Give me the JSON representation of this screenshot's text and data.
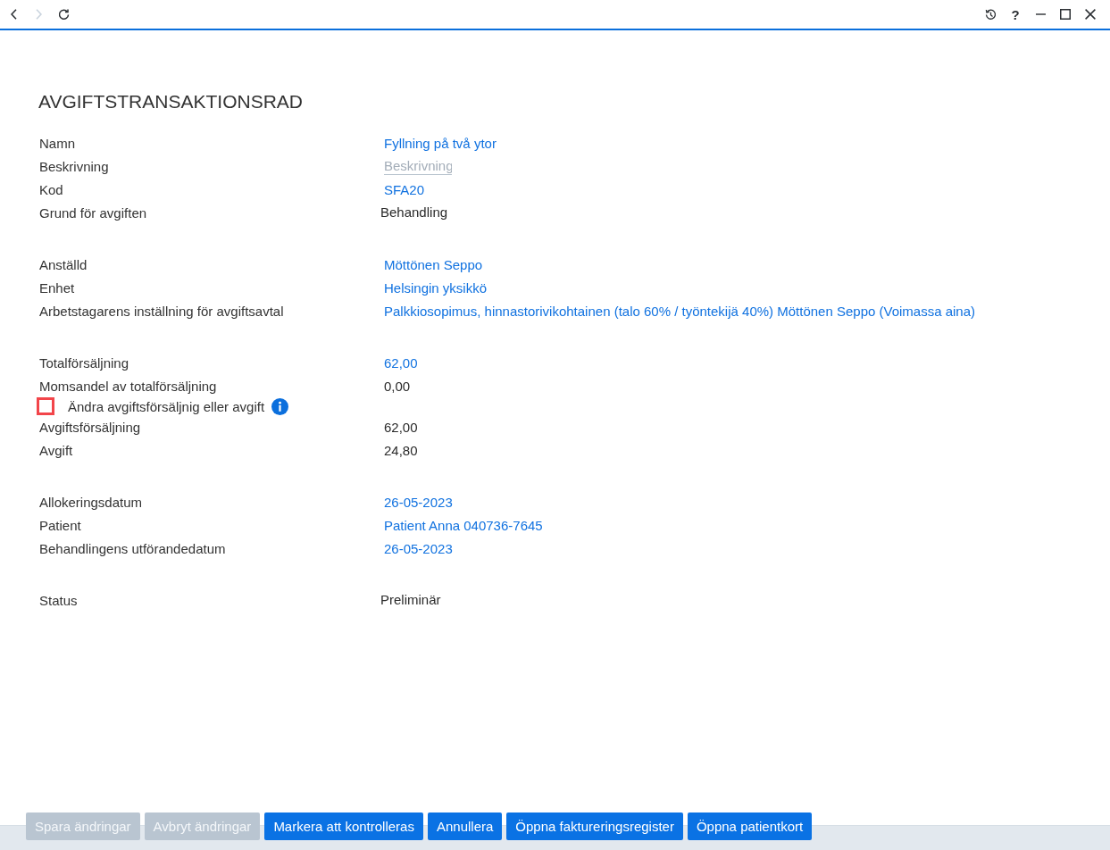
{
  "toolbar": {
    "nav": [
      {
        "kind": "back",
        "disabled": false
      },
      {
        "kind": "forward",
        "disabled": true
      },
      {
        "kind": "refresh",
        "disabled": false
      }
    ],
    "actions": [
      {
        "kind": "history"
      },
      {
        "kind": "help",
        "label": "?"
      },
      {
        "kind": "minimize"
      },
      {
        "kind": "maximize"
      },
      {
        "kind": "close"
      }
    ]
  },
  "title": "AVGIFTSTRANSAKTIONSRAD",
  "groups": [
    {
      "rows": [
        {
          "kind": "link",
          "label": "Namn",
          "value": "Fyllning på två ytor"
        },
        {
          "kind": "field",
          "label": "Beskrivning",
          "placeholder": "Beskrivning"
        },
        {
          "kind": "link",
          "label": "Kod",
          "value": "SFA20"
        },
        {
          "kind": "choice",
          "label": "Grund för avgiften",
          "value": "Behandling"
        }
      ]
    },
    {
      "rows": [
        {
          "kind": "link",
          "label": "Anställd",
          "value": "Möttönen Seppo"
        },
        {
          "kind": "link",
          "label": "Enhet",
          "value": "Helsingin yksikkö"
        },
        {
          "kind": "link",
          "label": "Arbetstagarens inställning för avgiftsavtal",
          "value": "Palkkiosopimus, hinnastorivikohtainen (talo 60% / työntekijä 40%) Möttönen Seppo (Voimassa aina)"
        }
      ]
    },
    {
      "rows": [
        {
          "kind": "link",
          "label": "Totalförsäljning",
          "value": "62,00"
        },
        {
          "kind": "text",
          "label": "Momsandel av totalförsäljning",
          "value": "0,00"
        },
        {
          "kind": "checkbox",
          "label": "Ändra avgiftsförsäljnig eller avgift",
          "checked": false,
          "info": true
        },
        {
          "kind": "text",
          "label": "Avgiftsförsäljning",
          "value": "62,00"
        },
        {
          "kind": "text",
          "label": "Avgift",
          "value": "24,80"
        }
      ]
    },
    {
      "rows": [
        {
          "kind": "link",
          "label": "Allokeringsdatum",
          "value": "26-05-2023"
        },
        {
          "kind": "link",
          "label": "Patient",
          "value": "Patient Anna 040736-7645"
        },
        {
          "kind": "link",
          "label": "Behandlingens utförandedatum",
          "value": "26-05-2023"
        }
      ]
    },
    {
      "rows": [
        {
          "kind": "choice",
          "label": "Status",
          "value": "Preliminär"
        }
      ]
    }
  ],
  "footer": {
    "buttons": [
      {
        "label": "Spara ändringar",
        "disabled": true
      },
      {
        "label": "Avbryt ändringar",
        "disabled": true
      },
      {
        "label": "Markera att kontrolleras",
        "disabled": false
      },
      {
        "label": "Annullera",
        "disabled": false
      },
      {
        "label": "Öppna faktureringsregister",
        "disabled": false
      },
      {
        "label": "Öppna patientkort",
        "disabled": false
      }
    ]
  }
}
